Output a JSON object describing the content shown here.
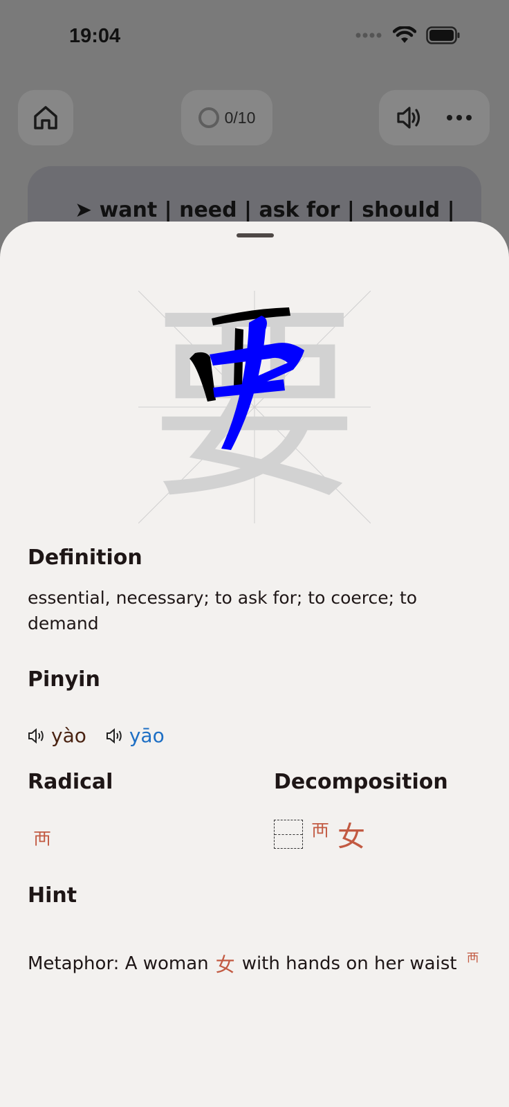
{
  "status_bar": {
    "time": "19:04"
  },
  "topbar": {
    "progress": "0/10",
    "progress_fraction": 0,
    "icons": [
      "home-icon",
      "speaker-icon",
      "more-icon"
    ]
  },
  "background_card": {
    "text": "➤ want | need | ask for | should |"
  },
  "character": {
    "glyph": "要",
    "stroke_colors": {
      "done": "#000000",
      "current": "#0000ff",
      "pending": "#d2d2d2"
    }
  },
  "definition": {
    "title": "Definition",
    "text": "essential, necessary; to ask for; to coerce; to demand"
  },
  "pinyin": {
    "title": "Pinyin",
    "readings": [
      "yào",
      "yāo"
    ]
  },
  "radical": {
    "title": "Radical",
    "glyph": "襾"
  },
  "decomposition": {
    "title": "Decomposition",
    "parts": [
      "襾",
      "女"
    ]
  },
  "hint": {
    "title": "Hint",
    "text_before": "Metaphor: A woman",
    "glyph1": "女",
    "text_after": "with hands on her waist",
    "glyph2": "襾"
  }
}
